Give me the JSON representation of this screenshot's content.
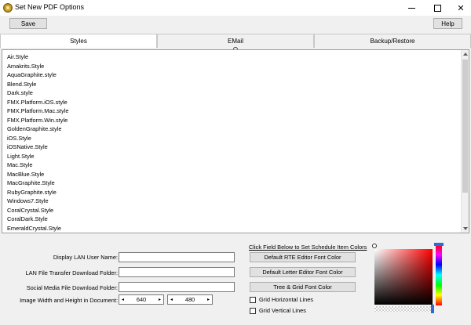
{
  "window": {
    "title": "Set New PDF Options"
  },
  "toolbar": {
    "save_label": "Save",
    "help_label": "Help"
  },
  "tabs": [
    {
      "label": "Styles",
      "active": true
    },
    {
      "label": "EMail",
      "active": false
    },
    {
      "label": "Backup/Restore",
      "active": false
    }
  ],
  "styles_list": [
    "Air.Style",
    "Amakrits.Style",
    "AquaGraphite.style",
    "Blend.Style",
    "Dark.style",
    "FMX.Platform.iOS.style",
    "FMX.Platform.Mac.style",
    "FMX.Platform.Win.style",
    "GoldenGraphite.style",
    "iOS.Style",
    "iOSNative.Style",
    "Light.Style",
    "Mac.Style",
    "MacBlue.Style",
    "MacGraphite.Style",
    "RubyGraphite.style",
    "Windows7.Style",
    "CoralCrystal.Style",
    "CoralDark.Style",
    "EmeraldCrystal.Style"
  ],
  "form": {
    "lan_user_label": "Display LAN User Name:",
    "lan_user_value": "",
    "lan_folder_label": "LAN File Transfer Download Folder:",
    "lan_folder_value": "",
    "social_folder_label": "Social Media File Download Folder:",
    "social_folder_value": "",
    "image_size_label": "Image Width and Height in Document:",
    "image_width": "640",
    "image_height": "480"
  },
  "colors": {
    "link_text": "Click Field Below to Set Schedule Item Colors",
    "rte_button": "Default RTE Editor Font Color",
    "letter_button": "Default Letter Editor Font Color",
    "tree_button": "Tree & Grid Font Color",
    "grid_horizontal": "Grid Horizontal Lines",
    "grid_vertical": "Grid Vertical Lines",
    "picker_hue": "#ff0000",
    "accent": "#2d6bd4"
  }
}
